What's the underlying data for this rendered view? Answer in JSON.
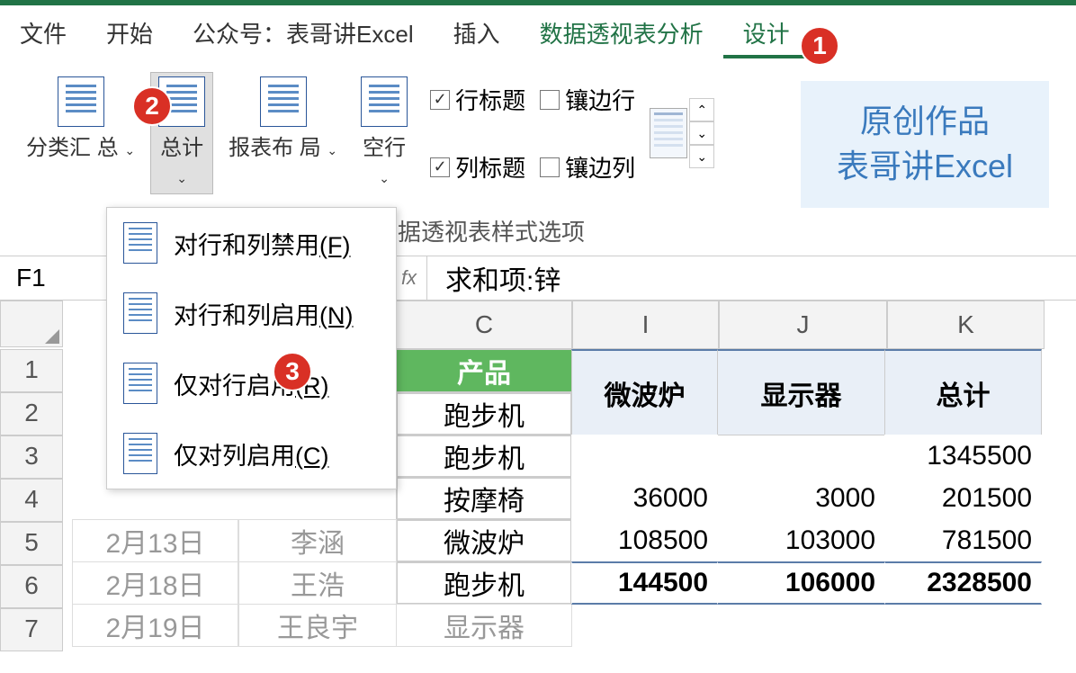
{
  "menu": {
    "file": "文件",
    "home": "开始",
    "account": "公众号：表哥讲Excel",
    "insert": "插入",
    "analyze": "数据透视表分析",
    "design": "设计"
  },
  "ribbon": {
    "subtotals": "分类汇\n总",
    "totals": "总计",
    "layout": "报表布\n局",
    "blank_rows": "空行",
    "row_headers": "行标题",
    "col_headers": "列标题",
    "banded_rows": "镶边行",
    "banded_cols": "镶边列",
    "group_label": "据透视表样式选项"
  },
  "watermark": {
    "line1": "原创作品",
    "line2": "表哥讲Excel"
  },
  "dropdown": {
    "opt1": "对行和列禁用",
    "opt1_key": "(F)",
    "opt2": "对行和列启用",
    "opt2_key": "(N)",
    "opt3": "仅对行启用",
    "opt3_key": "(R)",
    "opt4": "仅对列启用",
    "opt4_key": "(C)"
  },
  "formula": {
    "cell_ref": "F1",
    "fx": "fx",
    "value": "求和项:锌"
  },
  "headers": {
    "c": "C",
    "i": "I",
    "j": "J",
    "k": "K"
  },
  "rows": [
    "1",
    "2",
    "3",
    "4",
    "5",
    "6",
    "7"
  ],
  "table": {
    "c_header": "产品",
    "i_header": "微波炉",
    "j_header": "显示器",
    "k_header": "总计",
    "c2": "跑步机",
    "c3": "跑步机",
    "c4": "按摩椅",
    "c5": "微波炉",
    "c6": "跑步机",
    "c7": "显示器",
    "a5": "2月13日",
    "a6": "2月18日",
    "a7": "2月19日",
    "b5": "李涵",
    "b6": "王浩",
    "b7": "王良宇",
    "i4": "36000",
    "i5": "108500",
    "i6": "144500",
    "j4": "3000",
    "j5": "103000",
    "j6": "106000",
    "k3": "1345500",
    "k4": "201500",
    "k5": "781500",
    "k6": "2328500"
  },
  "badges": {
    "b1": "1",
    "b2": "2",
    "b3": "3"
  }
}
